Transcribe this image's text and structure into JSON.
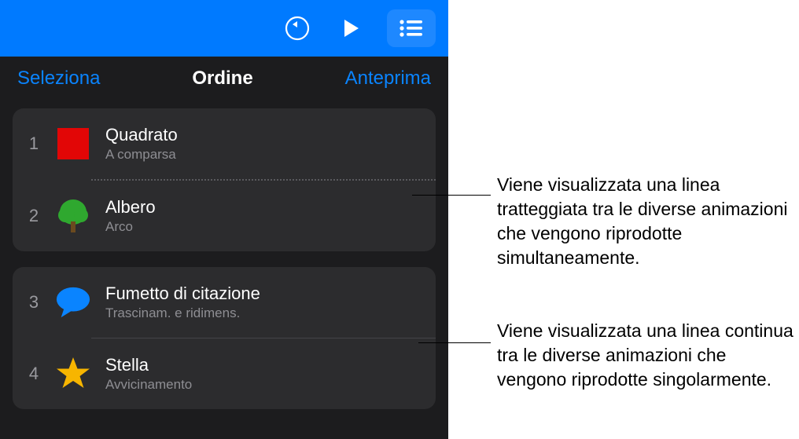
{
  "segments": {
    "select": "Seleziona",
    "order": "Ordine",
    "preview": "Anteprima"
  },
  "groups": [
    {
      "rows": [
        {
          "num": "1",
          "title": "Quadrato",
          "sub": "A comparsa",
          "icon": "square"
        },
        {
          "num": "2",
          "title": "Albero",
          "sub": "Arco",
          "icon": "tree"
        }
      ],
      "divider": "dotted"
    },
    {
      "rows": [
        {
          "num": "3",
          "title": "Fumetto di citazione",
          "sub": "Trascinam. e ridimens.",
          "icon": "bubble"
        },
        {
          "num": "4",
          "title": "Stella",
          "sub": "Avvicinamento",
          "icon": "star"
        }
      ],
      "divider": "solid"
    }
  ],
  "callouts": {
    "dotted": "Viene visualizzata una linea tratteggiata tra le diverse animazioni che vengono riprodotte simultaneamente.",
    "solid": "Viene visualizzata una linea continua tra le diverse animazioni che vengono riprodotte singolarmente."
  }
}
